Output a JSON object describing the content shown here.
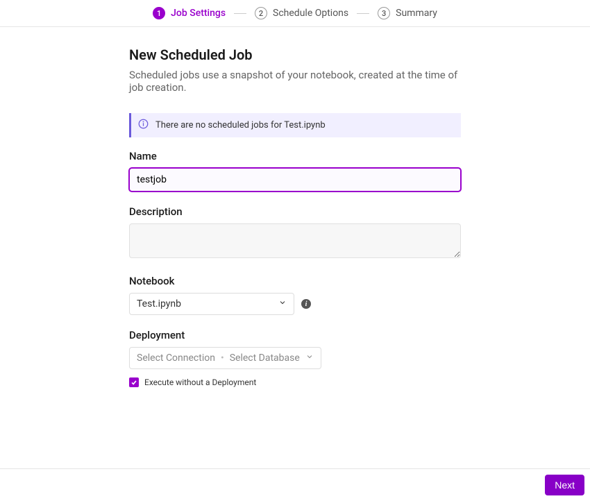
{
  "stepper": {
    "steps": [
      {
        "num": "1",
        "label": "Job Settings",
        "active": true
      },
      {
        "num": "2",
        "label": "Schedule Options",
        "active": false
      },
      {
        "num": "3",
        "label": "Summary",
        "active": false
      }
    ]
  },
  "page": {
    "title": "New Scheduled Job",
    "subtitle": "Scheduled jobs use a snapshot of your notebook, created at the time of job creation."
  },
  "banner": {
    "text": "There are no scheduled jobs for Test.ipynb"
  },
  "form": {
    "name_label": "Name",
    "name_value": "testjob",
    "description_label": "Description",
    "description_value": "",
    "notebook_label": "Notebook",
    "notebook_value": "Test.ipynb",
    "deployment_label": "Deployment",
    "deployment_connection_placeholder": "Select Connection",
    "deployment_database_placeholder": "Select Database",
    "execute_without_deployment_label": "Execute without a Deployment",
    "execute_without_deployment_checked": true
  },
  "footer": {
    "next_label": "Next"
  }
}
